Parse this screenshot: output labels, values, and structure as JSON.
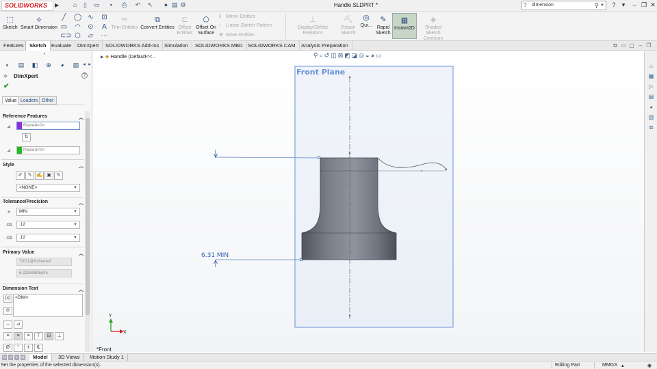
{
  "app": {
    "logo_text": "SOLIDWORKS",
    "document_title": "Handle.SLDPRT *"
  },
  "search": {
    "value": "dimension"
  },
  "ribbon": {
    "sketch": "Sketch",
    "smart_dimension": "Smart Dimension",
    "trim_entities": "Trim Entities",
    "convert_entities": "Convert Entities",
    "offset_entities": "Offset Entities",
    "offset_on_surface_1": "Offset On",
    "offset_on_surface_2": "Surface",
    "mirror_entities": "Mirror Entities",
    "linear_sketch_pattern": "Linear Sketch Pattern",
    "move_entities": "Move Entities",
    "display_delete_relations": "Display/Delete Relations",
    "repair_sketch": "Repair Sketch",
    "quick_snaps": "Qui...",
    "rapid_sketch": "Rapid Sketch",
    "instant2d": "Instant2D",
    "shaded_sketch_contours": "Shaded Sketch Contours"
  },
  "command_tabs": [
    "Features",
    "Sketch",
    "Evaluate",
    "DimXpert",
    "SOLIDWORKS Add-Ins",
    "Simulation",
    "SOLIDWORKS MBD",
    "SOLIDWORKS CAM",
    "Analysis Preparation"
  ],
  "property_manager": {
    "title": "DimXpert",
    "sub_tabs": [
      "Value",
      "Leaders",
      "Other"
    ],
    "reference_features": {
      "header": "Reference Features",
      "ref1": "Plane4<0>",
      "ref2": "Plane3<0>",
      "ref1_color": "#8b2fe0",
      "ref2_color": "#22bb22"
    },
    "style": {
      "header": "Style",
      "value": "<NONE>"
    },
    "tolerance": {
      "header": "Tolerance/Precision",
      "type": "MIN",
      "precision1": ".12",
      "precision2": ".12"
    },
    "primary_value": {
      "header": "Primary Value",
      "name": "TXD1@Scheme2",
      "value": "6.31269806mm"
    },
    "dimension_text": {
      "header": "Dimension Text",
      "value": "<DIM>"
    }
  },
  "graphics": {
    "tree_item": "Handle  (Default<<..",
    "plane_label": "Front Plane",
    "dimension_label": "6.31 MIN",
    "view_label": "*Front",
    "triad_x": "X",
    "triad_y": "Y",
    "plane_color": "#6a92d8",
    "part_color": "#5d6470"
  },
  "bottom_tabs": [
    "Model",
    "3D Views",
    "Motion Study 1"
  ],
  "status": {
    "message": "Set the properties of the selected dimension(s).",
    "mode": "Editing Part",
    "units": "MMGS"
  }
}
